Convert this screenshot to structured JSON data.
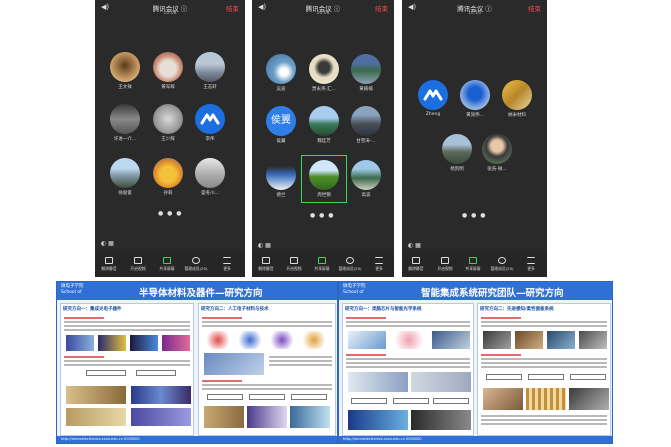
{
  "phones": [
    {
      "title": "腾讯会议 ⓘ",
      "time": "10:08",
      "end": "结束"
    },
    {
      "title": "腾讯会议 ⓘ",
      "time": "10:08",
      "end": "结束"
    },
    {
      "title": "腾讯会议 ⓘ",
      "time": "10:10",
      "end": "结束"
    }
  ],
  "phone1": {
    "names": [
      "王文祥",
      "黄军辉",
      "王志轩",
      "许进一介...",
      "王少辉",
      "李伟",
      "徐俊俊",
      "孙莉",
      "盛冬川..."
    ]
  },
  "phone2": {
    "names": [
      "吴迪",
      "贾永英-汇...",
      "黄楠楠",
      "侯翼",
      "魏廷芳",
      "甘雪涛-...",
      "德兰",
      "周世钢",
      "高波"
    ],
    "avatar_text": "侯翼"
  },
  "phone3": {
    "names": [
      "Zheng",
      "黄润伟...",
      "纳米材料",
      "杨凯明",
      "张浩-微..."
    ]
  },
  "bottombar": [
    "解除静音",
    "开启视频",
    "共享屏幕",
    "管理成员(20)",
    "更多"
  ],
  "poster1": {
    "logo1": "微电子学院",
    "logo2": "School of",
    "title": "半导体材料及器件—研究方向",
    "panel1": "研究方向一：集成光电子器件",
    "panel2": "研究方向二：人工电子材料与技术",
    "footer": "http://microelectronics.xxxx.edu.cn 0000000"
  },
  "poster2": {
    "logo1": "微电子学院",
    "logo2": "School of",
    "title": "智能集成系统研究团队—研究方向",
    "panel1": "研究方向一：类脑芯片与智能光学系统",
    "panel2": "研究方向二：先进感知/柔性面板系统",
    "footer": "http://microelectronics.xxxx.edu.cn 0000000"
  },
  "colors": {
    "phone_bg": "#2a2a2a",
    "end_red": "#ff4a4a",
    "poster_blue": "#2f6fd6"
  }
}
